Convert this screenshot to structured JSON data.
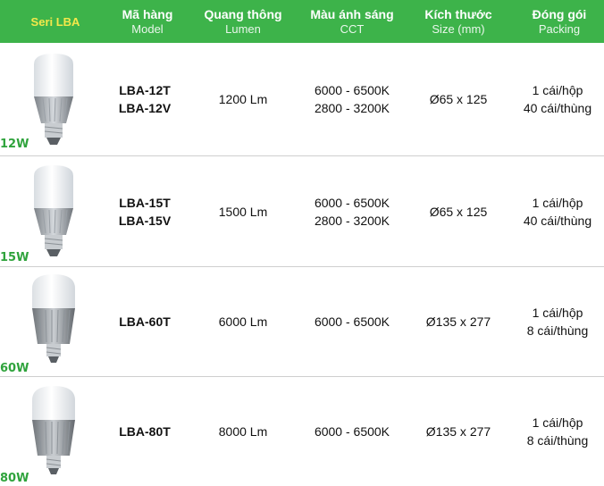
{
  "header": {
    "series": "Seri LBA",
    "model": {
      "vi": "Mã hàng",
      "en": "Model"
    },
    "lumen": {
      "vi": "Quang thông",
      "en": "Lumen"
    },
    "cct": {
      "vi": "Màu ánh sáng",
      "en": "CCT"
    },
    "size": {
      "vi": "Kích thước",
      "en": "Size (mm)"
    },
    "packing": {
      "vi": "Đóng gói",
      "en": "Packing"
    }
  },
  "rows": [
    {
      "watt": "12W",
      "model1": "LBA-12T",
      "model2": "LBA-12V",
      "lumen": "1200 Lm",
      "cct1": "6000 - 6500K",
      "cct2": "2800 - 3200K",
      "size": "Ø65 x 125",
      "pack1": "1 cái/hộp",
      "pack2": "40 cái/thùng"
    },
    {
      "watt": "15W",
      "model1": "LBA-15T",
      "model2": "LBA-15V",
      "lumen": "1500 Lm",
      "cct1": "6000 - 6500K",
      "cct2": "2800 - 3200K",
      "size": "Ø65 x 125",
      "pack1": "1 cái/hộp",
      "pack2": "40 cái/thùng"
    },
    {
      "watt": "60W",
      "model1": "LBA-60T",
      "lumen": "6000 Lm",
      "cct1": "6000 - 6500K",
      "size": "Ø135 x 277",
      "pack1": "1 cái/hộp",
      "pack2": "8 cái/thùng"
    },
    {
      "watt": "80W",
      "model1": "LBA-80T",
      "lumen": "8000 Lm",
      "cct1": "6000 - 6500K",
      "size": "Ø135 x 277",
      "pack1": "1 cái/hộp",
      "pack2": "8 cái/thùng"
    }
  ],
  "colors": {
    "header_bg": "#3db34a",
    "series_label": "#f5e84a",
    "watt_text": "#2fa33c"
  },
  "icons": [
    "led-bulb-icon"
  ]
}
